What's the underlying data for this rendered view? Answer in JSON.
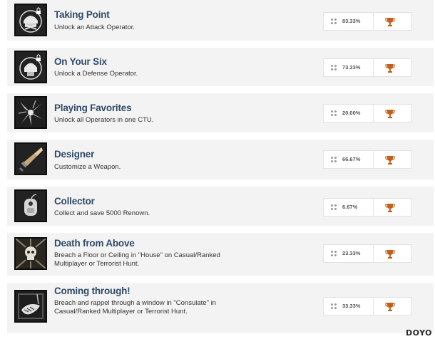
{
  "colors": {
    "title": "#2f4b68",
    "row_background": "#f3f3f3",
    "trophy": "#c0601c"
  },
  "achievements": [
    {
      "title": "Taking Point",
      "description": "Unlock an Attack Operator.",
      "percent": "83.33%",
      "icon": "operator-helmet-lock-icon"
    },
    {
      "title": "On Your Six",
      "description": "Unlock a Defense Operator.",
      "percent": "73.33%",
      "icon": "operator-helmet-lock-icon"
    },
    {
      "title": "Playing Favorites",
      "description": "Unlock all Operators in one CTU.",
      "percent": "20.00%",
      "icon": "shattered-emblem-icon"
    },
    {
      "title": "Designer",
      "description": "Customize a Weapon.",
      "percent": "66.67%",
      "icon": "weapon-blade-icon"
    },
    {
      "title": "Collector",
      "description": "Collect and save 5000 Renown.",
      "percent": "6.67%",
      "icon": "renown-tag-icon"
    },
    {
      "title": "Death from Above",
      "description": "Breach a Floor or Ceiling in \"House\" on Casual/Ranked Multiplayer or Terrorist Hunt.",
      "percent": "23.33%",
      "icon": "skull-breach-icon"
    },
    {
      "title": "Coming through!",
      "description": "Breach and rappel through a window in \"Consulate\" in Casual/Ranked Multiplayer or Terrorist Hunt.",
      "percent": "33.33%",
      "icon": "rappel-window-icon"
    }
  ],
  "watermark": "DOYO"
}
